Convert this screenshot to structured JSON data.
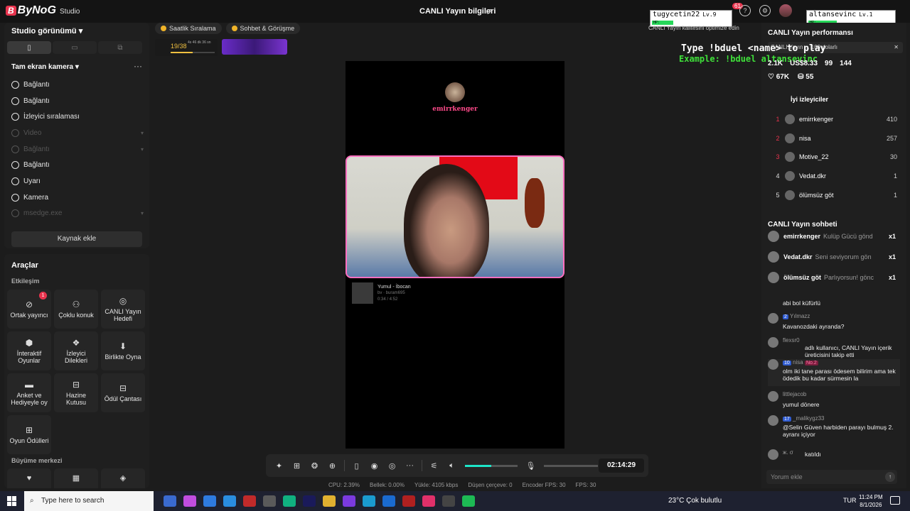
{
  "topbar": {
    "app_name": "ByNoG",
    "app_sub": "Studio",
    "stream_title": "CANLI Yayın bilgileri",
    "notification_count": "61"
  },
  "left": {
    "studio_view": "Studio görünümü",
    "scene_label": "Tam ekran kamera",
    "sources": [
      {
        "label": "Bağlantı",
        "dim": false
      },
      {
        "label": "Bağlantı",
        "dim": false
      },
      {
        "label": "İzleyici sıralaması",
        "dim": false
      },
      {
        "label": "Video",
        "dim": true
      },
      {
        "label": "Bağlantı",
        "dim": true
      },
      {
        "label": "Bağlantı",
        "dim": false
      },
      {
        "label": "Uyarı",
        "dim": false
      },
      {
        "label": "Kamera",
        "dim": false
      },
      {
        "label": "msedge.exe",
        "dim": true
      }
    ],
    "add_source": "Kaynak ekle",
    "tools_title": "Araçlar",
    "interaction_title": "Etkileşim",
    "tools": [
      {
        "label": "Ortak yayıncı",
        "badge": "1"
      },
      {
        "label": "Çoklu konuk",
        "badge": ""
      },
      {
        "label": "CANLI Yayın Hedefi",
        "badge": ""
      },
      {
        "label": "İnteraktif Oyunlar",
        "badge": ""
      },
      {
        "label": "İzleyici Dilekleri",
        "badge": ""
      },
      {
        "label": "Birlikte Oyna",
        "badge": ""
      },
      {
        "label": "Anket ve Hediyeyle oy",
        "badge": ""
      },
      {
        "label": "Hazine Kutusu",
        "badge": ""
      },
      {
        "label": "Ödül Çantası",
        "badge": ""
      },
      {
        "label": "Oyun Ödülleri",
        "badge": ""
      }
    ],
    "growth_title": "Büyüme merkezi"
  },
  "center": {
    "pill1": "Saatlik Sıralama",
    "pill2": "Sohbet & Görüşme",
    "goal_count": "19/38",
    "goal_time": "4s 46 dk 36 sn",
    "goal_progress": 0.5,
    "streamer_name": "emirrkenger",
    "music_title": "Yumul - İbocan",
    "music_artist": "bv · buram695",
    "music_time": "0:34 / 4:52",
    "timer": "02:14:29",
    "stats": [
      "CPU: 2.39%",
      "Bellek: 0.00%",
      "Yükle: 4105 kbps",
      "Düşen çerçeve: 0",
      "Encoder FPS: 30",
      "FPS: 30"
    ],
    "volume": 0.5
  },
  "overlay": {
    "player1_name": "tugycetin22",
    "player1_level": "Lv.9",
    "player2_name": "altansevinc",
    "player2_level": "Lv.1",
    "hp_label": "HP:",
    "type_line": "Type !bduel <name> to play",
    "example_line": "Example: !bduel altansevinc",
    "quality_tip": "CANLI Yayın kalitesini optimize edin"
  },
  "right": {
    "perf_title": "CANLI Yayın performansı",
    "toast": "CANLI Yayın ... 100 dolarlı",
    "stat_viewers": "2.1K",
    "stat_money": "US$8.33",
    "stat_follows": "99",
    "stat_other": "144",
    "stat_likes": "67K",
    "stat_gifts": "55",
    "top_viewers_title": "İyi izleyiciler",
    "viewers": [
      {
        "rank": "1",
        "name": "emirrkenger",
        "score": "410"
      },
      {
        "rank": "2",
        "name": "nisa",
        "score": "257"
      },
      {
        "rank": "3",
        "name": "Motive_22",
        "score": "30"
      },
      {
        "rank": "4",
        "name": "Vedat.dkr",
        "score": "1"
      },
      {
        "rank": "5",
        "name": "ölümsüz göt",
        "score": "1"
      }
    ],
    "chat_title": "CANLI Yayın sohbeti",
    "gifts": [
      {
        "name": "emirrkenger",
        "text": "Kulüp Gücü gönd",
        "count": "x1"
      },
      {
        "name": "Vedat.dkr",
        "text": "Seni seviyorum gön",
        "count": "x1"
      },
      {
        "name": "ölümsüz göt",
        "text": "Parlıyorsun! gönc",
        "count": "x1"
      }
    ],
    "messages": [
      {
        "user": "",
        "text": "abi bol küfürlü"
      },
      {
        "user": "Yılmazz",
        "badge": "2",
        "text": "Kavanozdaki ayranda?"
      },
      {
        "user": "flexsr0",
        "text": "adlı kullanıcı, CANLI Yayın içerik üreticisini takip etti"
      },
      {
        "user": "nisa",
        "badge": "10",
        "no": "No.2",
        "text": "olm iki tane parası ödesem bilirim ama tek ödedik bu kadar sürmesin la"
      },
      {
        "user": "littlejacob",
        "text": "yumul dönere"
      },
      {
        "user": "_malikygz33",
        "badge": "17",
        "text": "@Selin Güven harbiden parayı bulmuş 2. ayranı içiyor"
      },
      {
        "user": "ж. σ",
        "text": "katıldı"
      }
    ],
    "chat_placeholder": "Yorum ekle"
  },
  "taskbar": {
    "search_placeholder": "Type here to search",
    "weather": "23°C  Çok bulutlu",
    "lang": "TUR",
    "time": "11:24 PM",
    "date": "8/1/2026"
  }
}
